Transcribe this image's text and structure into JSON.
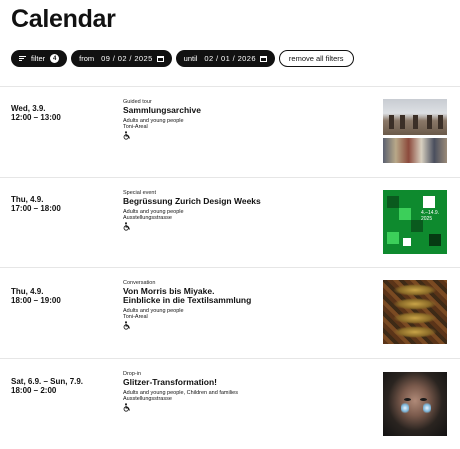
{
  "page": {
    "title": "Calendar"
  },
  "filters": {
    "filter_label": "filter",
    "filter_count": "4",
    "from_label": "from",
    "from_value": "09 / 02 / 2025",
    "until_label": "until",
    "until_value": "02 / 01 / 2026",
    "remove_all_label": "remove all filters"
  },
  "events": [
    {
      "date": "Wed, 3.9.",
      "time": "12:00 – 13:00",
      "category": "Guided tour",
      "title": "Sammlungsarchive",
      "audience": "Adults and young people",
      "venue": "Toni-Areal"
    },
    {
      "date": "Thu, 4.9.",
      "time": "17:00 – 18:00",
      "category": "Special event",
      "title": "Begrüssung Zurich Design Weeks",
      "audience": "Adults and young people",
      "venue": "Ausstellungsstrasse",
      "image_text": "4.–14.9.\n2025"
    },
    {
      "date": "Thu, 4.9.",
      "time": "18:00 – 19:00",
      "category": "Conversation",
      "title_line1": "Von Morris bis Miyake.",
      "title_line2": "Einblicke in die Textilsammlung",
      "audience": "Adults and young people",
      "venue": "Toni-Areal"
    },
    {
      "date": "Sat, 6.9. – Sun, 7.9.",
      "time": "18:00 – 2:00",
      "category": "Drop-in",
      "title": "Glitzer-Transformation!",
      "audience": "Adults and young people, Children and families",
      "venue": "Ausstellungsstrasse"
    }
  ],
  "icons": {
    "filter": "filter-icon",
    "calendar": "calendar-icon",
    "accessibility": "wheelchair-icon"
  },
  "colors": {
    "pill_background": "#111111",
    "pill_text": "#ffffff",
    "divider": "#e6e6e6",
    "design_weeks_green": "#0e8a2e"
  }
}
